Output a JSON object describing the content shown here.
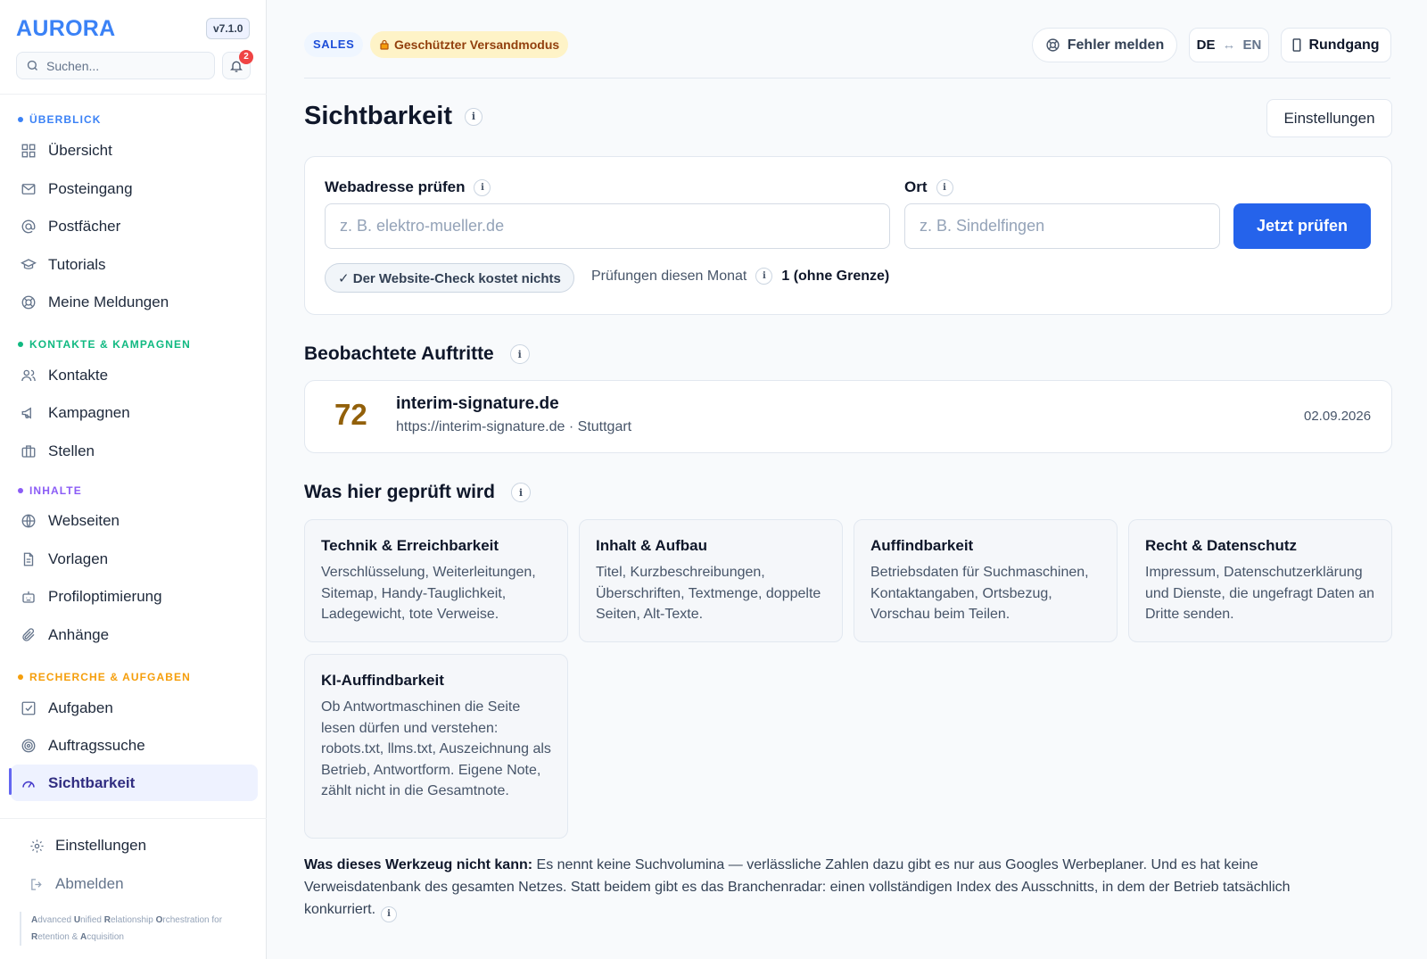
{
  "brand": {
    "name": "AURORA",
    "version": "v7.1.0"
  },
  "sidebar": {
    "search_placeholder": "Suchen...",
    "notification_count": "2",
    "sections": {
      "overview": "ÜBERBLICK",
      "contacts": "KONTAKTE & KAMPAGNEN",
      "content": "INHALTE",
      "research": "RECHERCHE & AUFGABEN"
    },
    "section_colors": {
      "overview": "#3b82f6",
      "contacts": "#10b981",
      "content": "#8b5cf6",
      "research": "#f59e0b"
    },
    "items": {
      "uebersicht": "Übersicht",
      "posteingang": "Posteingang",
      "postfaecher": "Postfächer",
      "tutorials": "Tutorials",
      "meldungen": "Meine Meldungen",
      "kontakte": "Kontakte",
      "kampagnen": "Kampagnen",
      "stellen": "Stellen",
      "webseiten": "Webseiten",
      "vorlagen": "Vorlagen",
      "profiloptimierung": "Profiloptimierung",
      "anhaenge": "Anhänge",
      "aufgaben": "Aufgaben",
      "auftragssuche": "Auftragssuche",
      "sichtbarkeit": "Sichtbarkeit"
    },
    "footer": {
      "settings": "Einstellungen",
      "logout": "Abmelden"
    },
    "tagline": [
      "A",
      "dvanced ",
      "U",
      "nified ",
      "R",
      "elationship ",
      "O",
      "rchestration for ",
      "R",
      "etention & ",
      "A",
      "cquisition"
    ]
  },
  "topbar": {
    "role_chip": "SALES",
    "mode_chip": "Geschützter Versandmodus",
    "report_button": "Fehler melden",
    "lang_de": "DE",
    "lang_arrow": "↔",
    "lang_en": "EN",
    "tour_button": "Rundgang"
  },
  "page": {
    "title": "Sichtbarkeit",
    "settings_button": "Einstellungen",
    "info_glyph": "i"
  },
  "check": {
    "url_label": "Webadresse prüfen",
    "url_placeholder": "z. B. elektro-mueller.de",
    "location_label": "Ort",
    "location_placeholder": "z. B. Sindelfingen",
    "submit": "Jetzt prüfen",
    "free_chip": "✓ Der Website-Check kostet nichts",
    "quota_label": "Prüfungen diesen Monat",
    "quota_value": "1 (ohne Grenze)"
  },
  "observed": {
    "heading": "Beobachtete Auftritte",
    "items": [
      {
        "score": "72",
        "name": "interim-signature.de",
        "subtitle": "https://interim-signature.de · Stuttgart",
        "date": "02.09.2026"
      }
    ]
  },
  "checks": {
    "heading": "Was hier geprüft wird",
    "cards": [
      {
        "title": "Technik & Erreichbarkeit",
        "text": "Verschlüsselung, Weiterleitungen, Sitemap, Handy-Tauglichkeit, Ladegewicht, tote Verweise."
      },
      {
        "title": "Inhalt & Aufbau",
        "text": "Titel, Kurzbeschreibungen, Überschriften, Textmenge, doppelte Seiten, Alt-Texte."
      },
      {
        "title": "Auffindbarkeit",
        "text": "Betriebsdaten für Suchmaschinen, Kontaktangaben, Ortsbezug, Vorschau beim Teilen."
      },
      {
        "title": "Recht & Datenschutz",
        "text": "Impressum, Datenschutzerklärung und Dienste, die ungefragt Daten an Dritte senden."
      },
      {
        "title": "KI-Auffindbarkeit",
        "text": "Ob Antwortmaschinen die Seite lesen dürfen und verstehen: robots.txt, llms.txt, Auszeichnung als Betrieb, Antwortform. Eigene Note, zählt nicht in die Gesamtnote."
      }
    ]
  },
  "note": {
    "bold": "Was dieses Werkzeug nicht kann:",
    "text": " Es nennt keine Suchvolumina — verlässliche Zahlen dazu gibt es nur aus Googles Werbeplaner. Und es hat keine Verweisdatenbank des gesamten Netzes. Statt beidem gibt es das Branchenradar: einen vollständigen Index des Ausschnitts, in dem der Betrieb tatsächlich konkurriert."
  },
  "colors": {
    "primary": "#2563eb",
    "accent": "#6366f1",
    "score": "#92600a",
    "warning_bg": "#fef3c7"
  }
}
